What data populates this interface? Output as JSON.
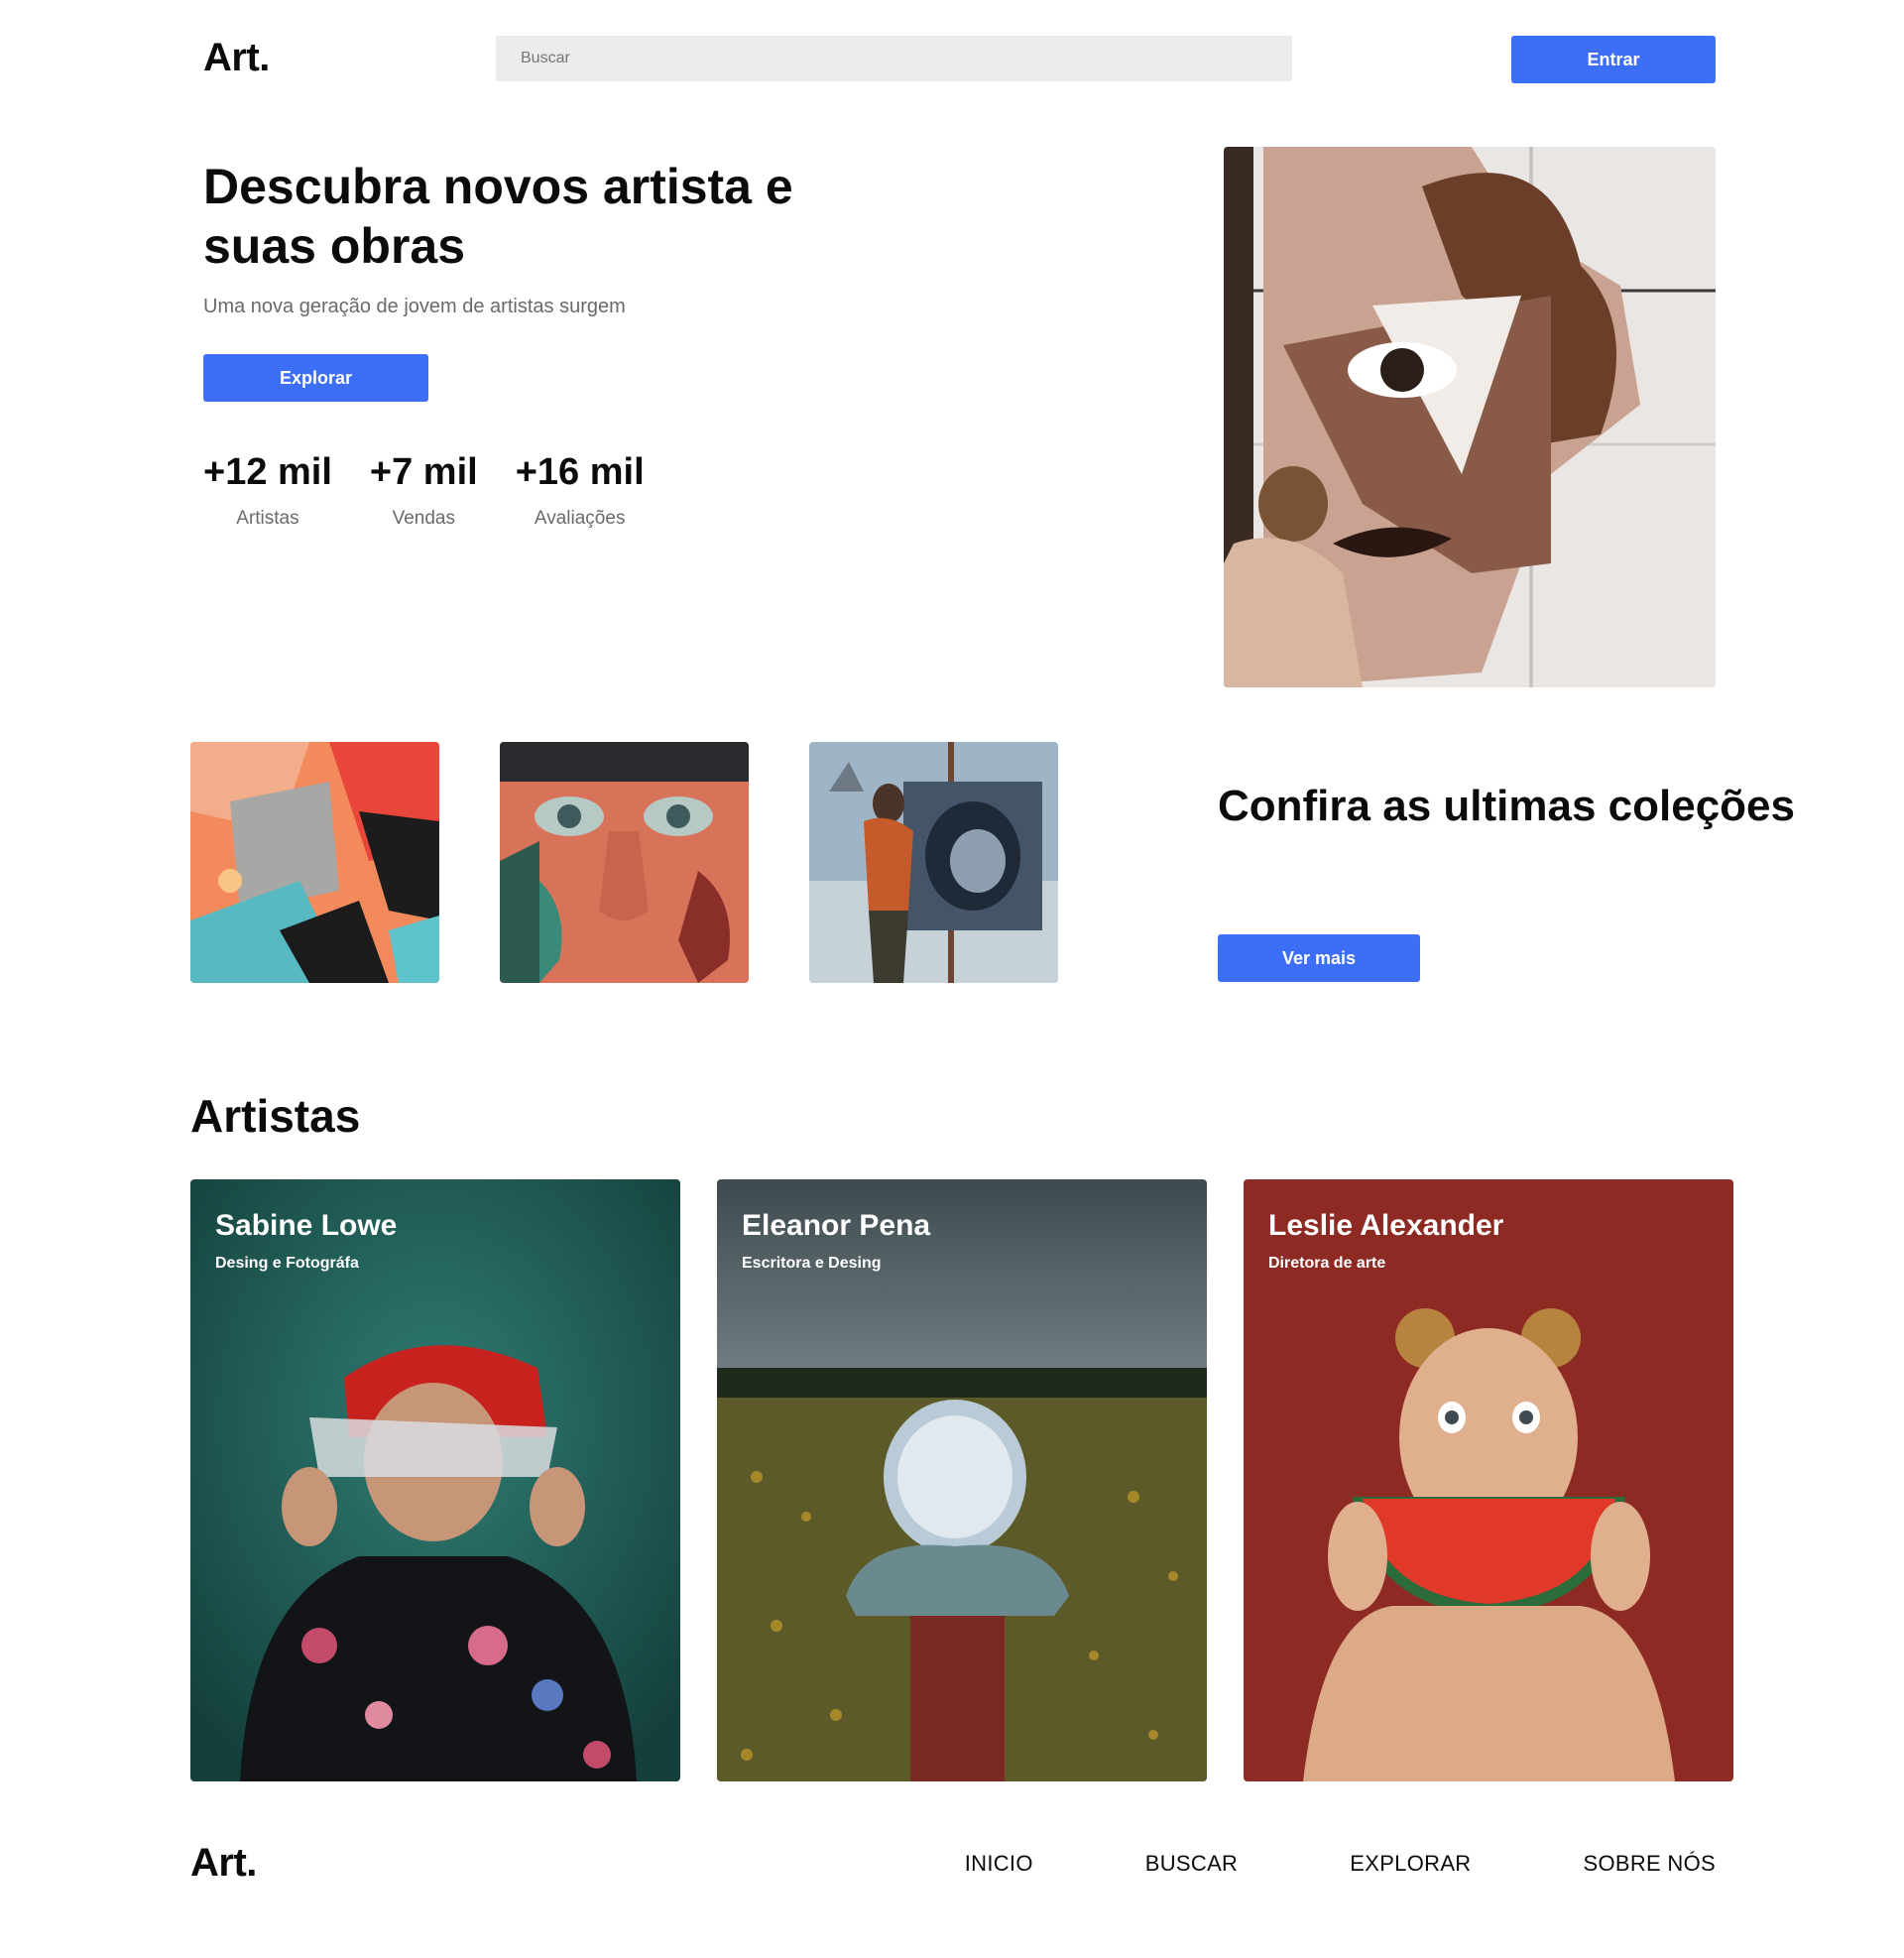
{
  "header": {
    "logo": "Art.",
    "search_placeholder": "Buscar",
    "login_label": "Entrar"
  },
  "hero": {
    "title": "Descubra novos artista e suas obras",
    "subtitle": "Uma nova geração de jovem de artistas surgem",
    "explore_label": "Explorar",
    "stats": [
      {
        "value": "+12 mil",
        "label": "Artistas"
      },
      {
        "value": "+7 mil",
        "label": "Vendas"
      },
      {
        "value": "+16 mil",
        "label": "Avaliações"
      }
    ]
  },
  "collections": {
    "title": "Confira as ultimas coleções",
    "more_label": "Ver mais"
  },
  "artists": {
    "title": "Artistas",
    "cards": [
      {
        "name": "Sabine Lowe",
        "role": "Desing e Fotográfa",
        "bg": "#1f5e58"
      },
      {
        "name": "Eleanor Pena",
        "role": "Escritora e Desing",
        "bg": "#56676b"
      },
      {
        "name": "Leslie Alexander",
        "role": "Diretora de arte",
        "bg": "#8e2a24"
      }
    ]
  },
  "footer": {
    "logo": "Art.",
    "nav": [
      "INICIO",
      "BUSCAR",
      "EXPLORAR",
      "SOBRE NÓS"
    ]
  },
  "colors": {
    "accent": "#3c6ef8",
    "search_bg": "#ececec"
  }
}
